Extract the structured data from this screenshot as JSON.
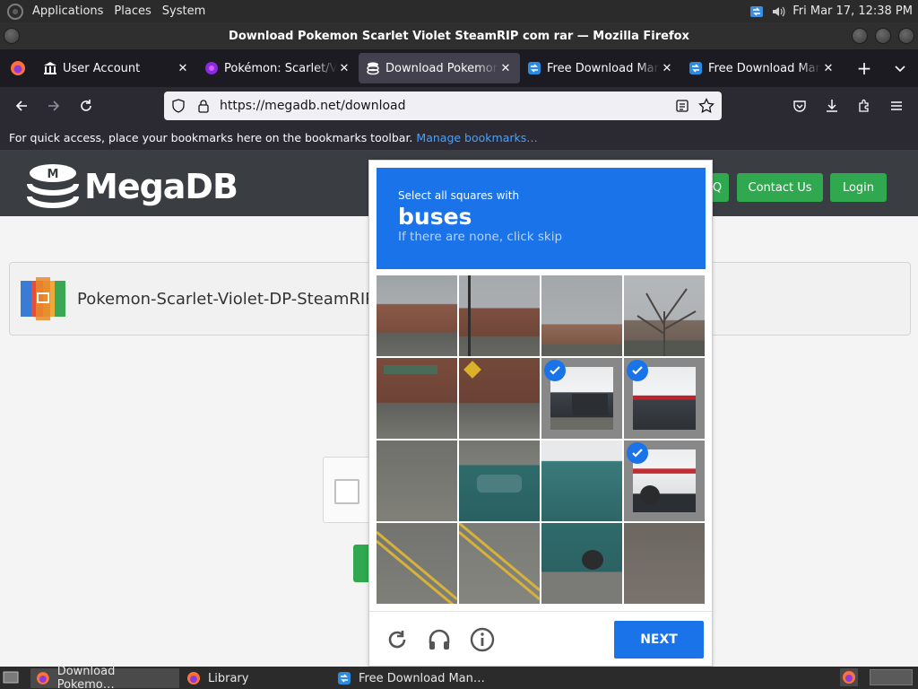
{
  "top_panel": {
    "menus": [
      "Applications",
      "Places",
      "System"
    ],
    "clock": "Fri Mar 17, 12:38 PM"
  },
  "window": {
    "title": "Download Pokemon Scarlet Violet SteamRIP com rar — Mozilla Firefox"
  },
  "tabs": [
    {
      "label": "User Account",
      "icon": "bank-icon",
      "active": false
    },
    {
      "label": "Pokémon: Scarlet/Vi",
      "icon": "pokemon-icon",
      "active": false
    },
    {
      "label": "Download Pokemon",
      "icon": "megadb-icon",
      "active": true
    },
    {
      "label": "Free Download Mana",
      "icon": "fdm-icon",
      "active": false
    },
    {
      "label": "Free Download Mana",
      "icon": "fdm-icon",
      "active": false
    }
  ],
  "navbar": {
    "url": "https://megadb.net/download"
  },
  "bookmarks": {
    "message": "For quick access, place your bookmarks here on the bookmarks toolbar.",
    "link": "Manage bookmarks…"
  },
  "site": {
    "logo_text": "MegaDB",
    "nav_partial": "Q",
    "contact_label": "Contact Us",
    "login_label": "Login",
    "file_name": "Pokemon-Scarlet-Violet-DP-SteamRIP.co"
  },
  "captcha": {
    "instruction": "Select all squares with",
    "target": "buses",
    "hint": "If there are none, click skip",
    "next_label": "NEXT",
    "selected_tiles": [
      6,
      7,
      11
    ],
    "colors": {
      "accent": "#1a73e8"
    }
  },
  "taskbar": {
    "tasks": [
      {
        "label": "Download Pokemo…",
        "icon": "firefox-icon",
        "active": true
      },
      {
        "label": "Library",
        "icon": "firefox-icon",
        "active": false
      },
      {
        "label": "Free Download Man…",
        "icon": "fdm-icon",
        "active": false
      }
    ]
  }
}
